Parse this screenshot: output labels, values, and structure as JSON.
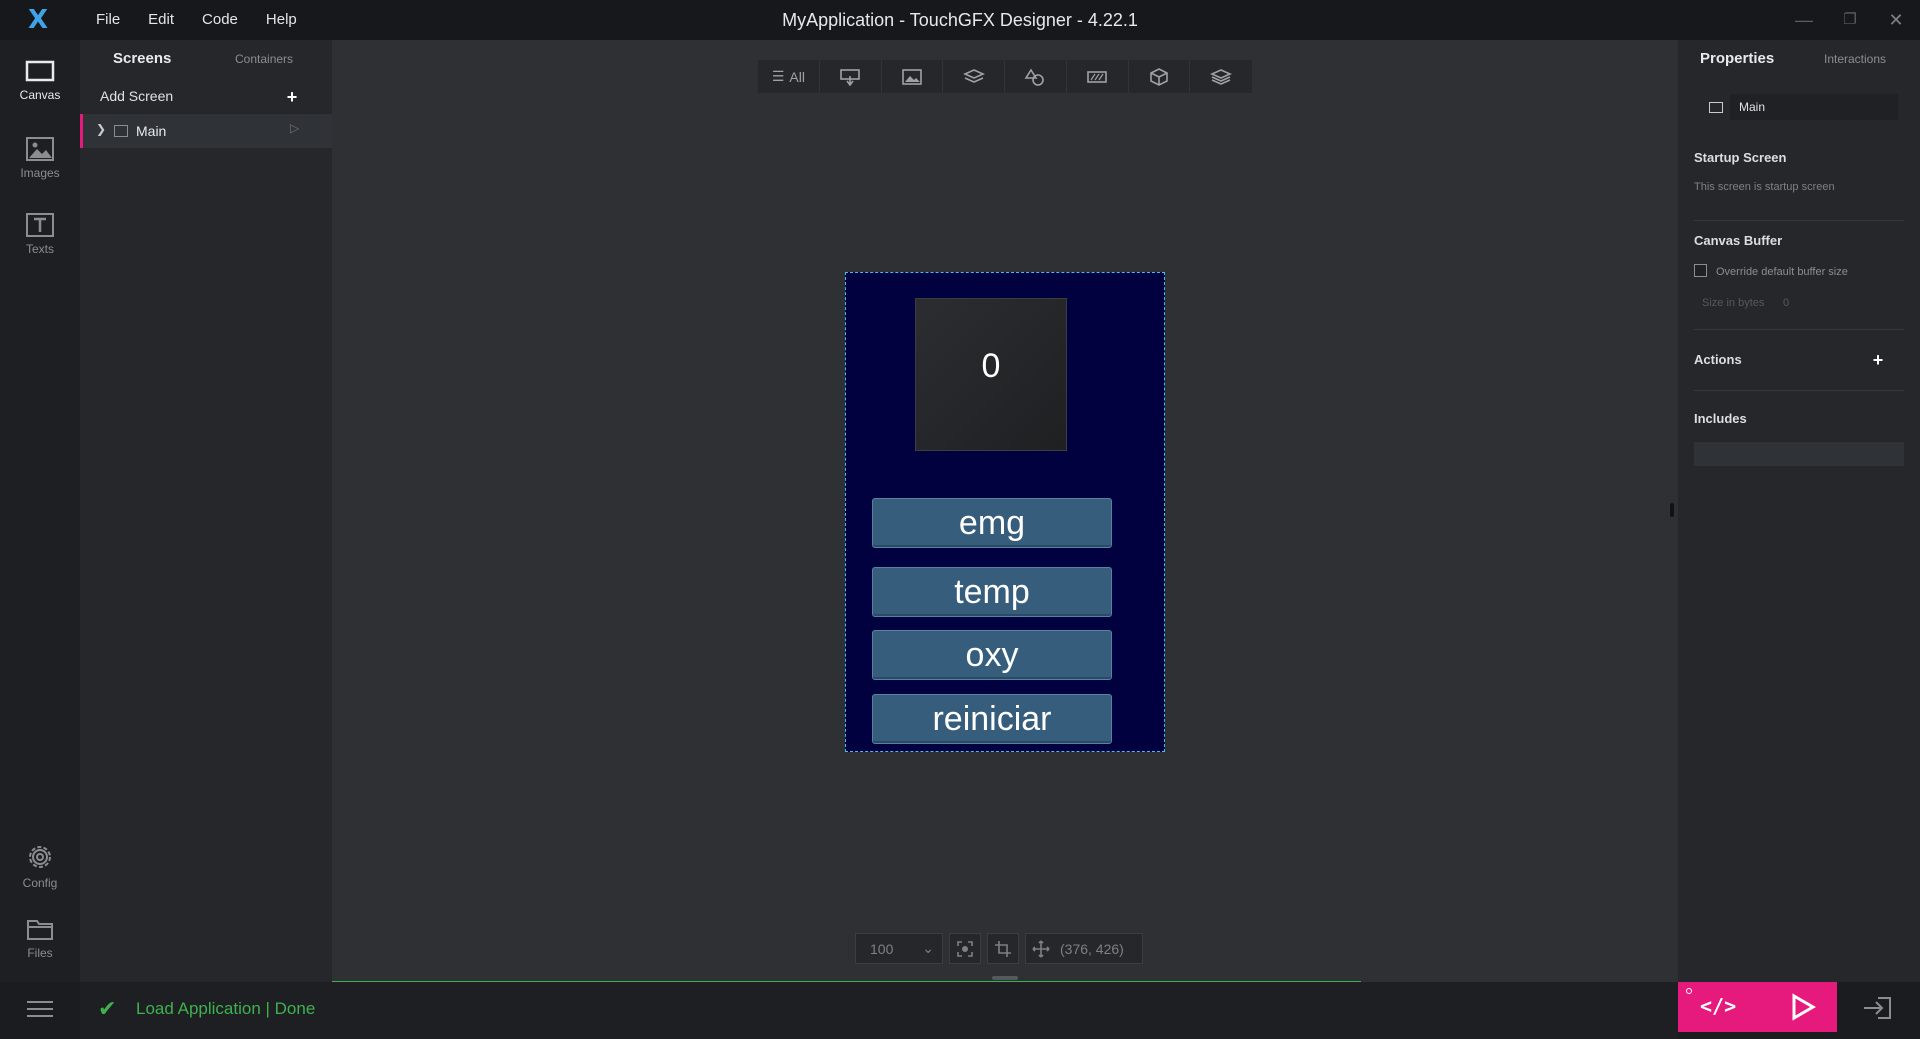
{
  "window": {
    "title": "MyApplication - TouchGFX Designer - 4.22.1",
    "logo_text": "X",
    "minimize": "—",
    "maximize": "❐",
    "close": "✕"
  },
  "menu": [
    "File",
    "Edit",
    "Code",
    "Help"
  ],
  "leftbar": {
    "items": [
      {
        "label": "Canvas",
        "icon": "canvas-icon"
      },
      {
        "label": "Images",
        "icon": "image-icon"
      },
      {
        "label": "Texts",
        "icon": "text-icon"
      }
    ],
    "bottom_items": [
      {
        "label": "Config",
        "icon": "gear-icon"
      },
      {
        "label": "Files",
        "icon": "folder-icon"
      }
    ]
  },
  "screens_panel": {
    "tabs": [
      "Screens",
      "Containers"
    ],
    "add_screen_label": "Add Screen",
    "add_icon": "+",
    "screens": [
      {
        "name": "Main"
      }
    ],
    "chevron": "❯",
    "play_glyph": "▷"
  },
  "canvas": {
    "toolbar_all": "All",
    "toolbar_icons": [
      "all-filter-icon",
      "interaction-icon",
      "image-widget-icon",
      "container-icon",
      "shape-icon",
      "keyboard-icon",
      "3d-icon",
      "layers-icon"
    ],
    "device": {
      "background": "#02013f",
      "display_value": "0",
      "buttons": [
        "emg",
        "temp",
        "oxy",
        "reiniciar"
      ]
    },
    "zoom": "100",
    "coords": "(376, 426)"
  },
  "properties": {
    "tabs": [
      "Properties",
      "Interactions"
    ],
    "screen_name": "Main",
    "startup_screen_heading": "Startup Screen",
    "startup_screen_text": "This screen is startup screen",
    "canvas_buffer_heading": "Canvas Buffer",
    "override_label": "Override default buffer size",
    "size_label": "Size in bytes",
    "size_value": "0",
    "actions_heading": "Actions",
    "includes_heading": "Includes"
  },
  "status": {
    "message": "Load Application  |  Done",
    "check": "✔"
  },
  "colors": {
    "accent": "#e6197d",
    "success": "#3fb14e",
    "brand": "#3fa3e6",
    "button": "#365e7c"
  }
}
